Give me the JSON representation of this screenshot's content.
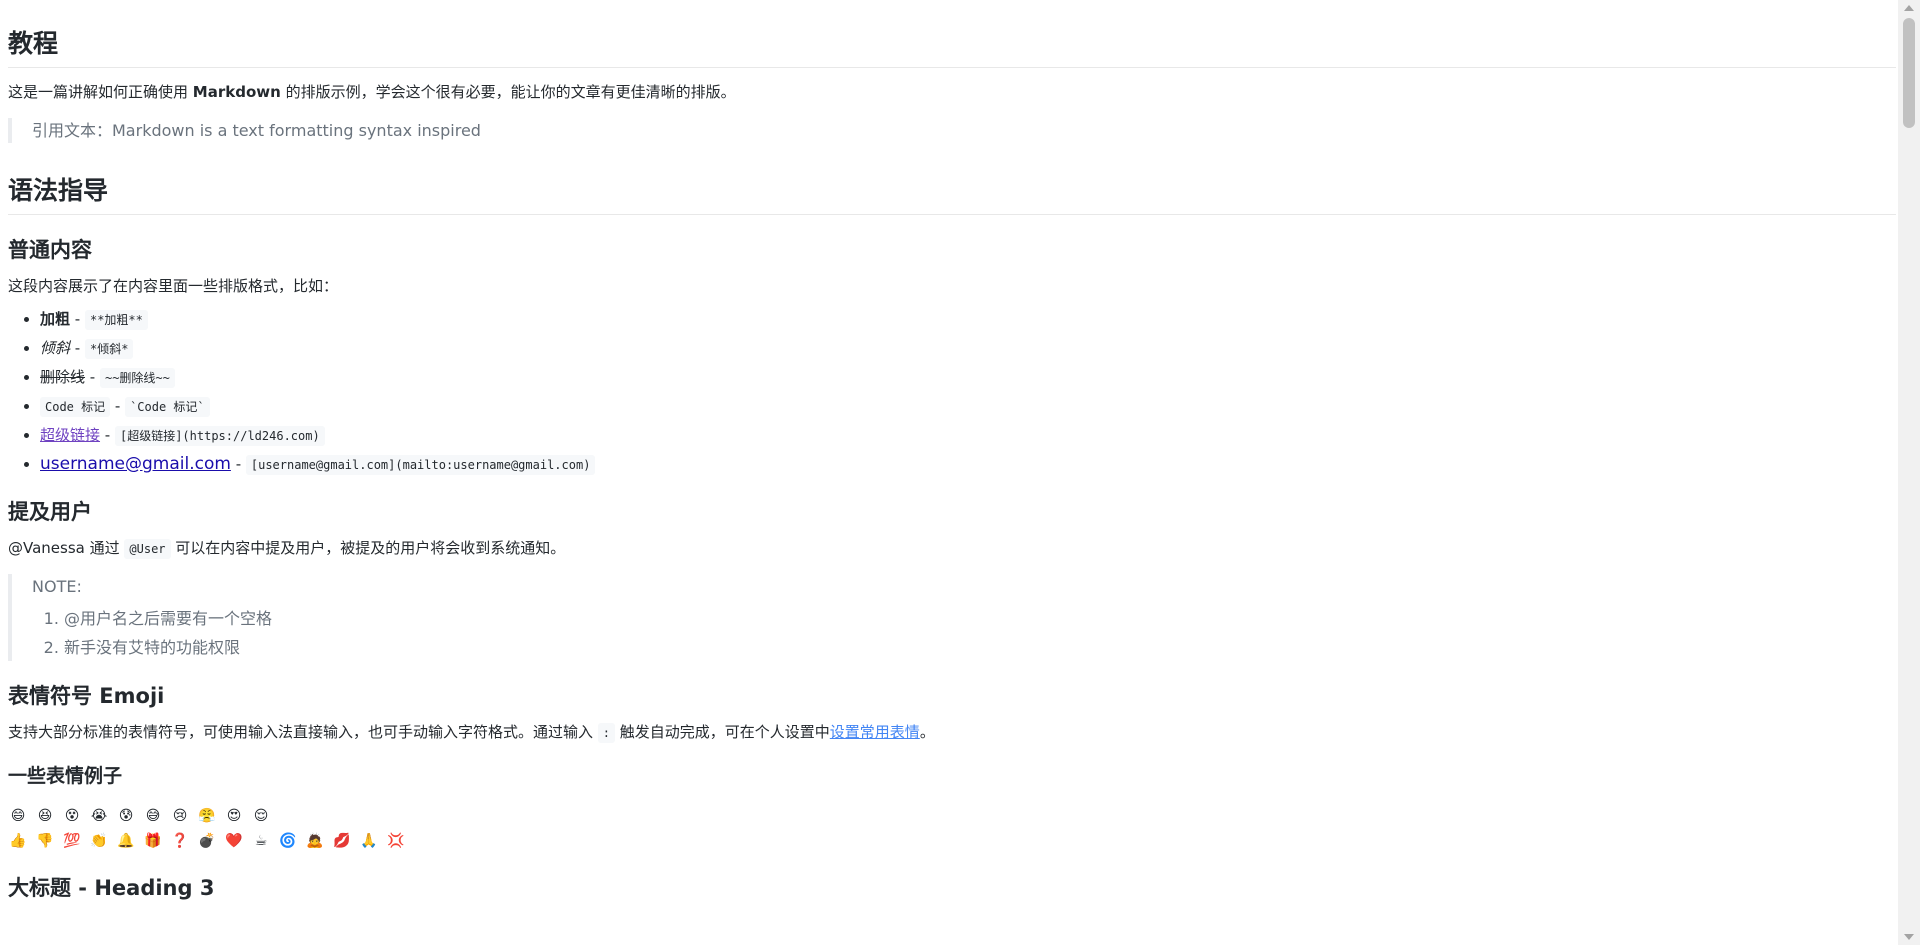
{
  "doc": {
    "h_tutorial": "教程",
    "intro_before": "这是一篇讲解如何正确使用 ",
    "intro_bold": "Markdown",
    "intro_after": " 的排版示例，学会这个很有必要，能让你的文章有更佳清晰的排版。",
    "quote": "引用文本：Markdown is a text formatting syntax inspired",
    "h_syntax": "语法指导",
    "h_normal": "普通内容",
    "normal_desc": "这段内容展示了在内容里面一些排版格式，比如：",
    "items": {
      "bold_label": "加粗",
      "bold_code": "**加粗**",
      "italic_label": "倾斜",
      "italic_code": "*倾斜*",
      "strike_label": "删除线",
      "strike_code": "~~删除线~~",
      "code_label": "Code 标记",
      "code_code": "`Code 标记`",
      "link_label": "超级链接",
      "link_code": "[超级链接](https://ld246.com)",
      "mail_label": "username@gmail.com",
      "mail_code": "[username@gmail.com](mailto:username@gmail.com)",
      "sep": " - "
    },
    "h_mention": "提及用户",
    "mention_user": "@Vanessa",
    "mention_mid": " 通过 ",
    "mention_code": "@User",
    "mention_after": " 可以在内容中提及用户，被提及的用户将会收到系统通知。",
    "note_title": "NOTE:",
    "note_items": [
      "@用户名之后需要有一个空格",
      "新手没有艾特的功能权限"
    ],
    "h_emoji": "表情符号 Emoji",
    "emoji_desc_before": "支持大部分标准的表情符号，可使用输入法直接输入，也可手动输入字符格式。通过输入 ",
    "emoji_desc_code": ":",
    "emoji_desc_mid": " 触发自动完成，可在个人设置中",
    "emoji_desc_link": "设置常用表情",
    "emoji_desc_end": "。",
    "h_emoji_examples": "一些表情例子",
    "emoji_row1": [
      "😄",
      "😆",
      "😵",
      "😭",
      "😰",
      "😅",
      "😢",
      "😤",
      "😍",
      "😌"
    ],
    "emoji_row2": [
      "👍",
      "👎",
      "💯",
      "👏",
      "🔔",
      "🎁",
      "❓",
      "💣",
      "❤️",
      "☕",
      "🌀",
      "🙇",
      "💋",
      "🙏",
      "💢"
    ],
    "h_heading3": "大标题 - Heading 3"
  }
}
